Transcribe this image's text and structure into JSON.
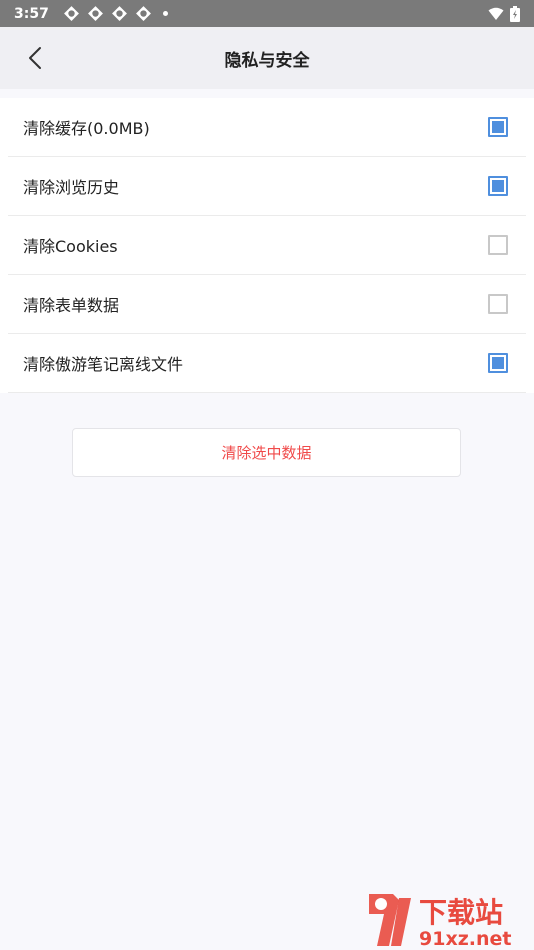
{
  "status_bar": {
    "time": "3:57"
  },
  "header": {
    "title": "隐私与安全"
  },
  "items": [
    {
      "label": "清除缓存(0.0MB)",
      "checked": true
    },
    {
      "label": "清除浏览历史",
      "checked": true
    },
    {
      "label": "清除Cookies",
      "checked": false
    },
    {
      "label": "清除表单数据",
      "checked": false
    },
    {
      "label": "清除傲游笔记离线文件",
      "checked": true
    }
  ],
  "clear_button_label": "清除选中数据",
  "watermark": {
    "text": "下载站",
    "domain": "91xz.net"
  },
  "colors": {
    "accent": "#4f8fde",
    "danger": "#f04a4a",
    "status_bar": "#7a7a7a"
  }
}
